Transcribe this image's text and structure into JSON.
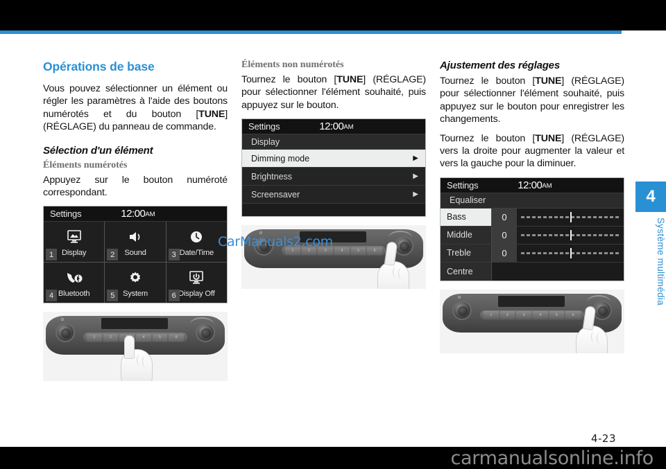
{
  "page": {
    "folio": "4-23",
    "watermark_bottom": "carmanualsonline.info",
    "watermark_mid": "CarManuals2.com",
    "accent_blue": "#2a90d4"
  },
  "chapter_tab": {
    "number": "4",
    "label": "Système multimédia"
  },
  "col1": {
    "heading": "Opérations de base",
    "intro_1": "Vous pouvez sélectionner un élément ou régler les paramètres à l'aide des boutons numérotés et du bouton [",
    "intro_tune": "TUNE",
    "intro_2": "] (RÉGLAGE) du panneau de commande.",
    "sub_heading": "Sélection d'un élément",
    "serif_heading": "Éléments numérotés",
    "body": "Appuyez sur le bouton numéroté correspondant."
  },
  "col2": {
    "serif_heading": "Éléments non numérotés",
    "body_1": "Tournez le bouton [",
    "body_tune": "TUNE",
    "body_2": "] (RÉGLAGE) pour sélectionner l'élément souhaité, puis appuyez sur le bouton."
  },
  "col3": {
    "heading": "Ajustement des réglages",
    "p1_1": "Tournez le bouton [",
    "p1_tune": "TUNE",
    "p1_2": "] (RÉGLAGE) pour sélectionner l'élément souhaité, puis appuyez sur le bouton pour enregistrer les changements.",
    "p2_1": "Tournez le bouton [",
    "p2_tune": "TUNE",
    "p2_2": "] (RÉGLAGE) vers la droite pour augmenter la valeur et vers la gauche pour la diminuer."
  },
  "screen_settings_grid": {
    "title": "Settings",
    "clock": "12:00",
    "meridiem": "AM",
    "tiles": [
      {
        "num": "1",
        "label": "Display",
        "icon": "picture-monitor-icon",
        "glyph": "▣"
      },
      {
        "num": "2",
        "label": "Sound",
        "icon": "speaker-icon",
        "glyph": "🔊"
      },
      {
        "num": "3",
        "label": "Date/Time",
        "icon": "clock-icon",
        "glyph": "🕓"
      },
      {
        "num": "4",
        "label": "Bluetooth",
        "icon": "bluetooth-phone-icon",
        "glyph": "☎"
      },
      {
        "num": "5",
        "label": "System",
        "icon": "gear-icon",
        "glyph": "⚙"
      },
      {
        "num": "6",
        "label": "Display Off",
        "icon": "power-monitor-icon",
        "glyph": "⏻"
      }
    ]
  },
  "screen_display_menu": {
    "title": "Settings",
    "clock": "12:00",
    "meridiem": "AM",
    "submenu": "Display",
    "rows": [
      {
        "label": "Dimming mode",
        "selected": true,
        "arrow": "▶"
      },
      {
        "label": "Brightness",
        "selected": false,
        "arrow": "▶"
      },
      {
        "label": "Screensaver",
        "selected": false,
        "arrow": "▶"
      }
    ]
  },
  "screen_equaliser": {
    "title": "Settings",
    "clock": "12:00",
    "meridiem": "AM",
    "submenu": "Equaliser",
    "rows": [
      {
        "label": "Bass",
        "value": "0",
        "selected": true,
        "has_slider": true
      },
      {
        "label": "Middle",
        "value": "0",
        "selected": false,
        "has_slider": true
      },
      {
        "label": "Treble",
        "value": "0",
        "selected": false,
        "has_slider": true
      },
      {
        "label": "Centre",
        "value": "",
        "selected": false,
        "has_slider": false
      }
    ]
  },
  "panel_photos": {
    "keys": [
      "1",
      "2",
      "3",
      "4",
      "5",
      "6"
    ],
    "caption_numbered": "hand-pressing-number-button",
    "caption_knob_mid": "hand-pressing-tune-knob",
    "caption_knob_right": "hand-pressing-tune-knob"
  }
}
